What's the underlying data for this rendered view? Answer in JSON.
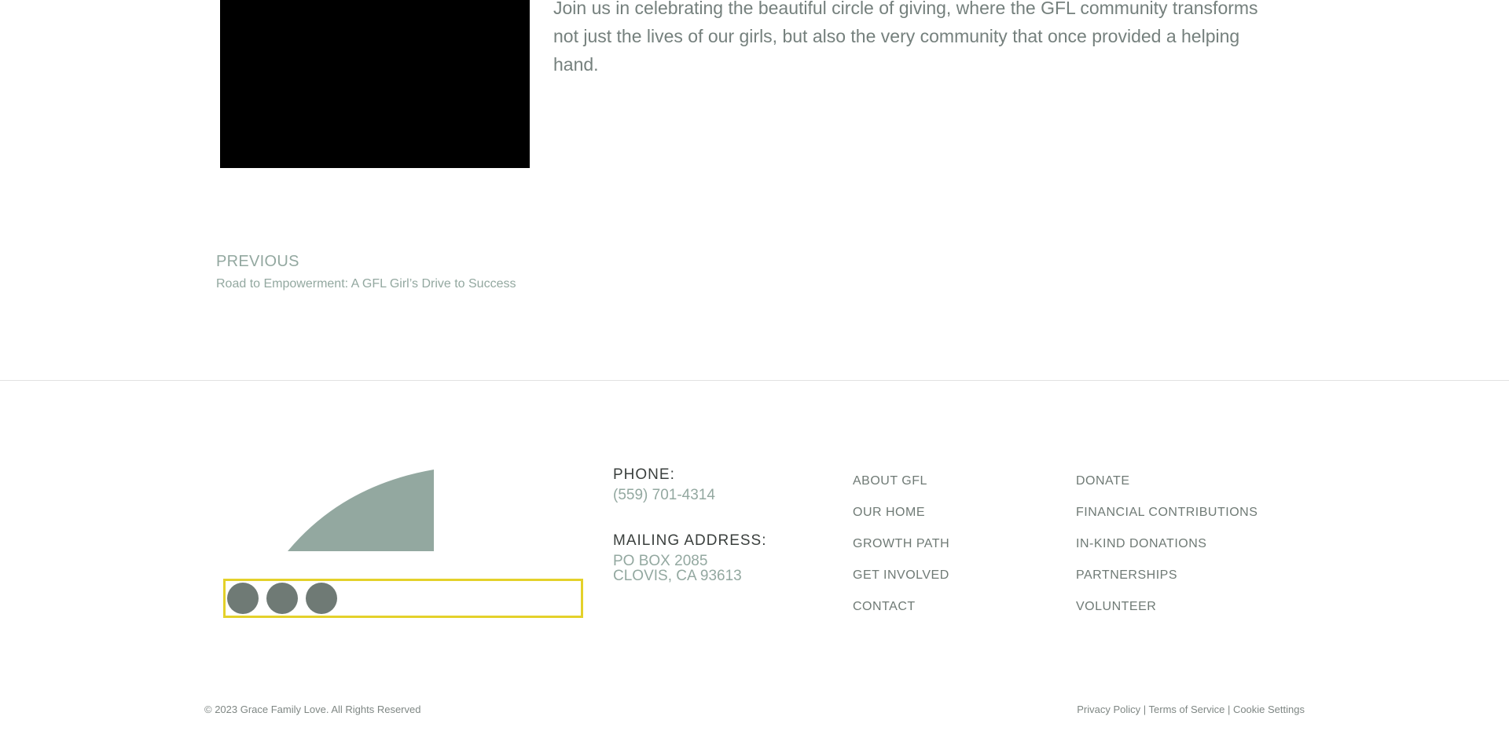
{
  "article": {
    "intro": "Join us in celebrating the beautiful circle of giving, where the GFL community transforms not just the lives of our girls, but also the very community that once provided a helping hand."
  },
  "post_nav": {
    "previous_label": "PREVIOUS",
    "previous_title": "Road to Empowerment: A GFL Girl’s Drive to Success"
  },
  "contact": {
    "phone_heading": "PHONE:",
    "phone_value": "(559) 701-4314",
    "address_heading": "MAILING ADDRESS:",
    "address_line1": "PO BOX 2085",
    "address_line2": "CLOVIS, CA 93613"
  },
  "footer_nav": {
    "col1": [
      "ABOUT GFL",
      "OUR HOME",
      "GROWTH PATH",
      "GET INVOLVED",
      "CONTACT"
    ],
    "col2": [
      "DONATE",
      "FINANCIAL CONTRIBUTIONS",
      "IN-KIND DONATIONS",
      "PARTNERSHIPS",
      "VOLUNTEER"
    ]
  },
  "footer": {
    "copyright": "© 2023 Grace Family Love. All Rights Reserved",
    "privacy": "Privacy Policy",
    "terms": "Terms of Service",
    "cookies": "Cookie Settings",
    "separator": " | "
  },
  "colors": {
    "accent": "#93a8a0",
    "social_border": "#e4d12a",
    "social_button": "#6f7a75"
  }
}
